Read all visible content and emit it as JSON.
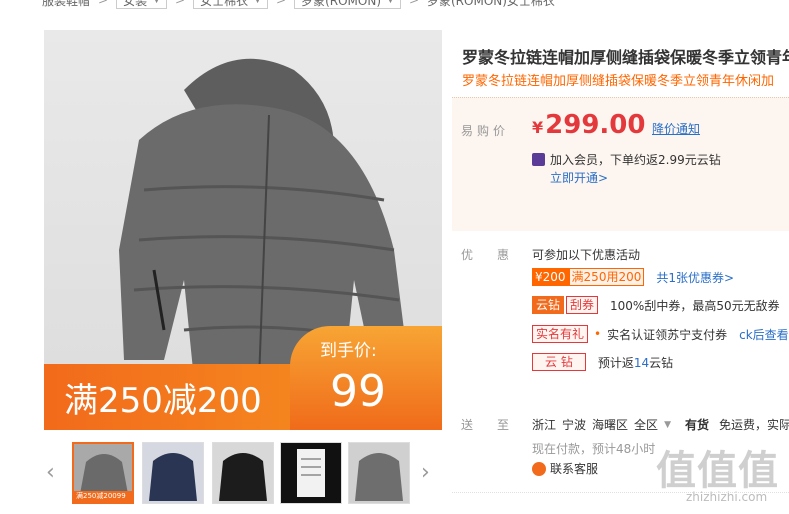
{
  "breadcrumb": {
    "first": "服装鞋帽",
    "drop1": "女装",
    "drop2": "女士棉衣",
    "drop3": "罗蒙(ROMON)",
    "last": "罗蒙(ROMON)女士棉衣"
  },
  "product": {
    "title": "罗蒙冬拉链连帽加厚侧缝插袋保暖冬季立领青年",
    "subtitle": "罗蒙冬拉链连帽加厚侧缝插袋保暖冬季立领青年休闲加"
  },
  "image_promo": {
    "left_text": "满250减200",
    "right_label": "到手价:",
    "right_value": "99"
  },
  "thumbnails": [
    {
      "name": "grey-jacket",
      "tag_left": "满250减200",
      "tag_right": "99"
    },
    {
      "name": "navy-jacket"
    },
    {
      "name": "black-jacket"
    },
    {
      "name": "label-tag"
    },
    {
      "name": "grey-jacket-2"
    }
  ],
  "price": {
    "label": "易购价",
    "currency": "¥",
    "value": "299.00",
    "notify": "降价通知",
    "member_text": "加入会员，下单约返2.99元云钻",
    "member_link": "立即开通>"
  },
  "promotions": {
    "label": "优惠",
    "head": "可参加以下优惠活动",
    "coupon_a": "¥200",
    "coupon_b": "满250用200",
    "coupon_link": "共1张优惠券>",
    "row2_tag1": "云钻",
    "row2_tag2": "刮券",
    "row2_text": "100%刮中券，最高50元无敌券",
    "row3_tag": "实名有礼",
    "row3_text": "实名认证领苏宁支付券",
    "row3_link": "ck后查看",
    "row4_tag": "云 钻",
    "row4_text_pre": "预计返",
    "row4_num": "14",
    "row4_text_post": "云钻"
  },
  "shipping": {
    "label": "送至",
    "province": "浙江",
    "city": "宁波",
    "district": "海曙区",
    "range": "全区",
    "stock": "有货",
    "fee": "免运费，实际",
    "note": "现在付款，预计48小时",
    "service": "联系客服"
  },
  "watermark": {
    "main": "值值值",
    "sub": "zhizhizhi.com"
  },
  "colors": {
    "accent": "#f26a1b",
    "price": "#e4393c",
    "link": "#2a6fc8"
  }
}
